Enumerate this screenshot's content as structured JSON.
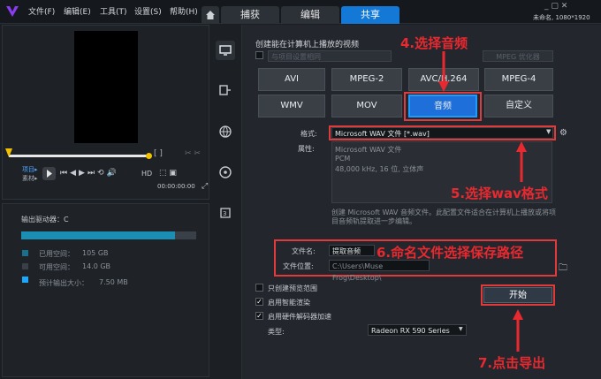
{
  "menu": {
    "file": "文件(F)",
    "edit": "编辑(E)",
    "tools": "工具(T)",
    "settings": "设置(S)",
    "help": "帮助(H)"
  },
  "tabs": {
    "capture": "捕获",
    "edit": "编辑",
    "share": "共享"
  },
  "window_info": "未命名, 1080*1920",
  "player": {
    "project_label": "项目▸",
    "clip_label": "素材▸",
    "timecode": "00:00:00:00",
    "hd": "HD"
  },
  "drive": {
    "label": "输出驱动器：C",
    "used_label": "已用空间：",
    "used_value": "105 GB",
    "free_label": "可用空间：",
    "free_value": "14.0 GB",
    "est_label": "预计输出大小：",
    "est_value": "7.50 MB",
    "used_fraction": 0.88
  },
  "share": {
    "header": "创建能在计算机上播放的视频",
    "match_project": "与项目设置相同",
    "mpeg_opt": "MPEG 优化器",
    "formats_row1": [
      "AVI",
      "MPEG-2",
      "AVC/H.264",
      "MPEG-4"
    ],
    "formats_row2": [
      "WMV",
      "MOV",
      "音频",
      "自定义"
    ],
    "selected": "音频",
    "format_label": "格式:",
    "format_value": "Microsoft WAV 文件 [*.wav]",
    "props_label": "属性:",
    "props_lines": [
      "Microsoft WAV 文件",
      "PCM",
      "48,000 kHz, 16 位, 立体声"
    ],
    "description": "创建 Microsoft WAV 音频文件。此配置文件适合在计算机上播放或将项目音频轨提取进一步编辑。",
    "filename_label": "文件名:",
    "filename_value": "提取音频",
    "location_label": "文件位置:",
    "location_value": "C:\\Users\\Muse Frog\\Desktop\\",
    "opt_preview": "只创建预览范围",
    "opt_smart": "启用智能渲染",
    "opt_hw": "启用硬件解码器加速",
    "type_label": "类型:",
    "type_value": "Radeon RX 590 Series",
    "start": "开始"
  },
  "annotations": {
    "a4": "4.选择音频",
    "a5": "5.选择wav格式",
    "a6": "6.命名文件选择保存路径",
    "a7": "7.点击导出"
  }
}
